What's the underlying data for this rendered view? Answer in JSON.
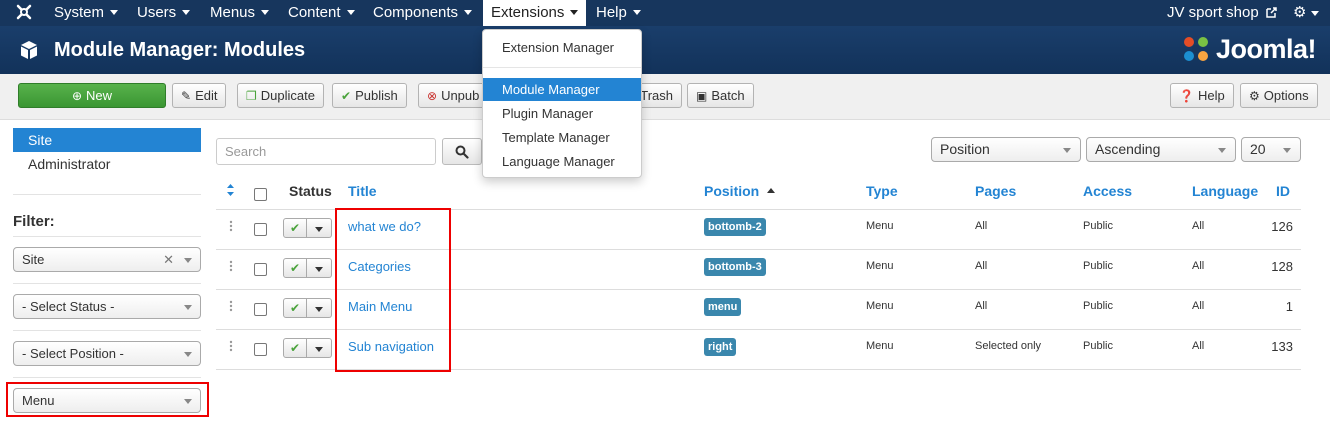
{
  "navbar": {
    "menus": [
      "System",
      "Users",
      "Menus",
      "Content",
      "Components",
      "Extensions",
      "Help"
    ],
    "site_link": "JV sport shop"
  },
  "header": {
    "title": "Module Manager: Modules",
    "brand": "Joomla!"
  },
  "toolbar": {
    "new_label": "New",
    "edit_label": "Edit",
    "duplicate_label": "Duplicate",
    "publish_label": "Publish",
    "unpublish_label": "Unpub",
    "trash_label": "Trash",
    "batch_label": "Batch",
    "help_label": "Help",
    "options_label": "Options"
  },
  "extensions_menu": {
    "items": [
      "Extension Manager",
      "Module Manager",
      "Plugin Manager",
      "Template Manager",
      "Language Manager"
    ],
    "active": "Module Manager"
  },
  "sidebar": {
    "items": [
      "Site",
      "Administrator"
    ],
    "active": "Site",
    "filter_label": "Filter:",
    "client_filter": "Site",
    "status_filter": "- Select Status -",
    "position_filter": "- Select Position -",
    "type_filter": "Menu"
  },
  "search": {
    "placeholder": "Search"
  },
  "sorting": {
    "order_by": "Position",
    "direction": "Ascending",
    "limit": "20"
  },
  "table": {
    "headers": {
      "status": "Status",
      "title": "Title",
      "position": "Position",
      "type": "Type",
      "pages": "Pages",
      "access": "Access",
      "language": "Language",
      "id": "ID"
    },
    "rows": [
      {
        "title": "what we do?",
        "position": "bottomb-2",
        "type": "Menu",
        "pages": "All",
        "access": "Public",
        "language": "All",
        "id": "126"
      },
      {
        "title": "Categories",
        "position": "bottomb-3",
        "type": "Menu",
        "pages": "All",
        "access": "Public",
        "language": "All",
        "id": "128"
      },
      {
        "title": "Main Menu",
        "position": "menu",
        "type": "Menu",
        "pages": "All",
        "access": "Public",
        "language": "All",
        "id": "1"
      },
      {
        "title": "Sub navigation",
        "position": "right",
        "type": "Menu",
        "pages": "Selected only",
        "access": "Public",
        "language": "All",
        "id": "133"
      }
    ]
  },
  "colors": {
    "navbar": "#17365d",
    "accent": "#2384d3",
    "badge": "#3a87ad",
    "success": "#4aa33b",
    "highlight": "#e00000"
  }
}
